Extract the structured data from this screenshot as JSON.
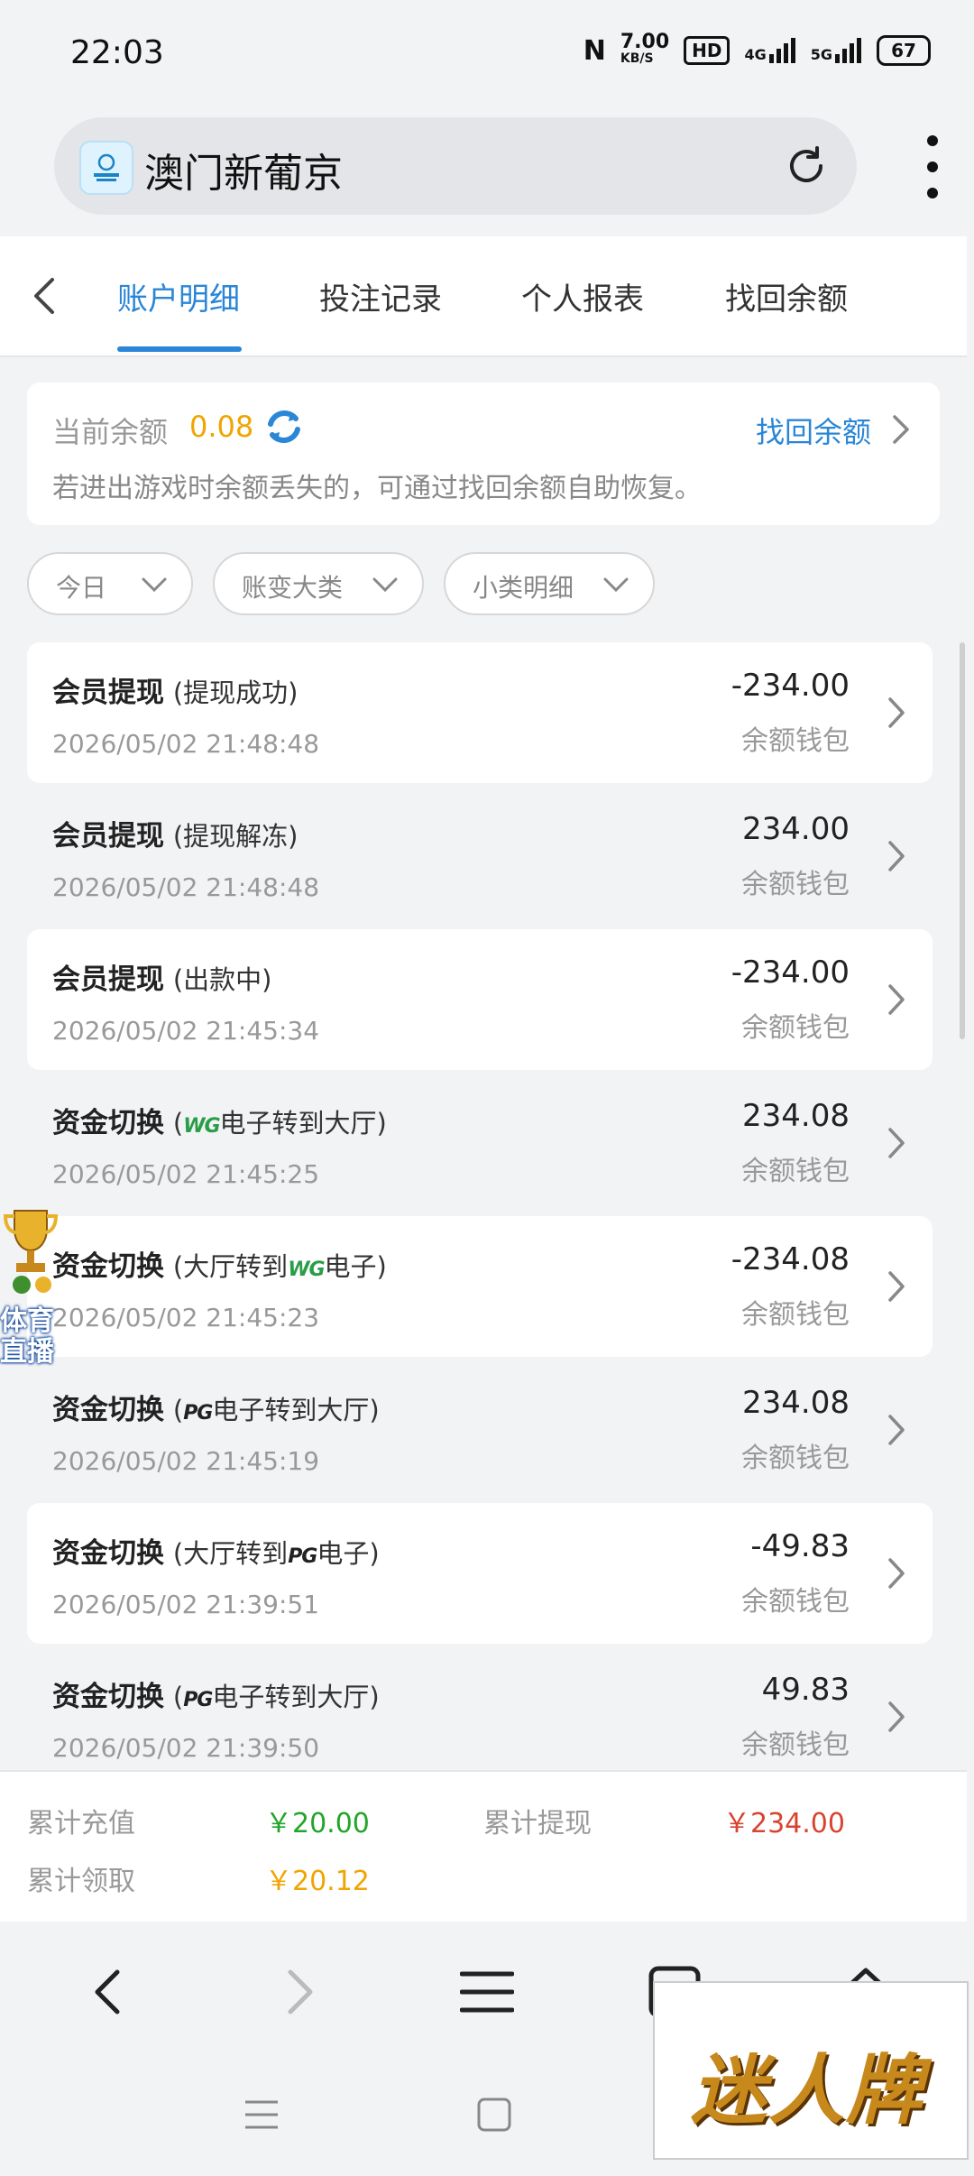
{
  "status_bar": {
    "time": "22:03",
    "net_speed": "7.00",
    "net_unit": "KB/S",
    "hd_label": "HD",
    "signal1": "4G",
    "signal2": "5G",
    "battery": "67"
  },
  "browser": {
    "site_title": "澳门新葡京",
    "logo_text": "澳门新葡京"
  },
  "tabs": [
    {
      "label": "账户明细",
      "active": true
    },
    {
      "label": "投注记录",
      "active": false
    },
    {
      "label": "个人报表",
      "active": false
    },
    {
      "label": "找回余额",
      "active": false
    }
  ],
  "balance": {
    "label": "当前余额",
    "value": "0.08",
    "link": "找回余额",
    "tip": "若进出游戏时余额丢失的，可通过找回余额自助恢复。"
  },
  "filters": [
    {
      "label": "今日"
    },
    {
      "label": "账变大类"
    },
    {
      "label": "小类明细"
    }
  ],
  "records": [
    {
      "title": "会员提现",
      "sub_pre": "(提现成功)",
      "brand": "",
      "sub_post": "",
      "time": "2026/05/02 21:48:48",
      "amount": "-234.00",
      "wallet": "余额钱包"
    },
    {
      "title": "会员提现",
      "sub_pre": "(提现解冻)",
      "brand": "",
      "sub_post": "",
      "time": "2026/05/02 21:48:48",
      "amount": "234.00",
      "wallet": "余额钱包"
    },
    {
      "title": "会员提现",
      "sub_pre": "(出款中)",
      "brand": "",
      "sub_post": "",
      "time": "2026/05/02 21:45:34",
      "amount": "-234.00",
      "wallet": "余额钱包"
    },
    {
      "title": "资金切换",
      "sub_pre": "(",
      "brand": "WG",
      "sub_post": "电子转到大厅)",
      "time": "2026/05/02 21:45:25",
      "amount": "234.08",
      "wallet": "余额钱包"
    },
    {
      "title": "资金切换",
      "sub_pre": "(大厅转到",
      "brand": "WG",
      "sub_post": "电子)",
      "time": "2026/05/02 21:45:23",
      "amount": "-234.08",
      "wallet": "余额钱包"
    },
    {
      "title": "资金切换",
      "sub_pre": "(",
      "brand": "PG",
      "sub_post": "电子转到大厅)",
      "time": "2026/05/02 21:45:19",
      "amount": "234.08",
      "wallet": "余额钱包"
    },
    {
      "title": "资金切换",
      "sub_pre": "(大厅转到",
      "brand": "PG",
      "sub_post": "电子)",
      "time": "2026/05/02 21:39:51",
      "amount": "-49.83",
      "wallet": "余额钱包"
    },
    {
      "title": "资金切换",
      "sub_pre": "(",
      "brand": "PG",
      "sub_post": "电子转到大厅)",
      "time": "2026/05/02 21:39:50",
      "amount": "49.83",
      "wallet": "余额钱包"
    }
  ],
  "floater": {
    "text": "体育直播"
  },
  "summary": {
    "recharge_label": "累计充值",
    "recharge_value": "￥20.00",
    "withdraw_label": "累计提现",
    "withdraw_value": "￥234.00",
    "claim_label": "累计领取",
    "claim_value": "￥20.12"
  },
  "colors": {
    "accent": "#2a86d6",
    "positive": "#22a52a",
    "negative": "#d9432f",
    "gold": "#f0a500"
  },
  "watermark": {
    "text": "迷人牌"
  }
}
